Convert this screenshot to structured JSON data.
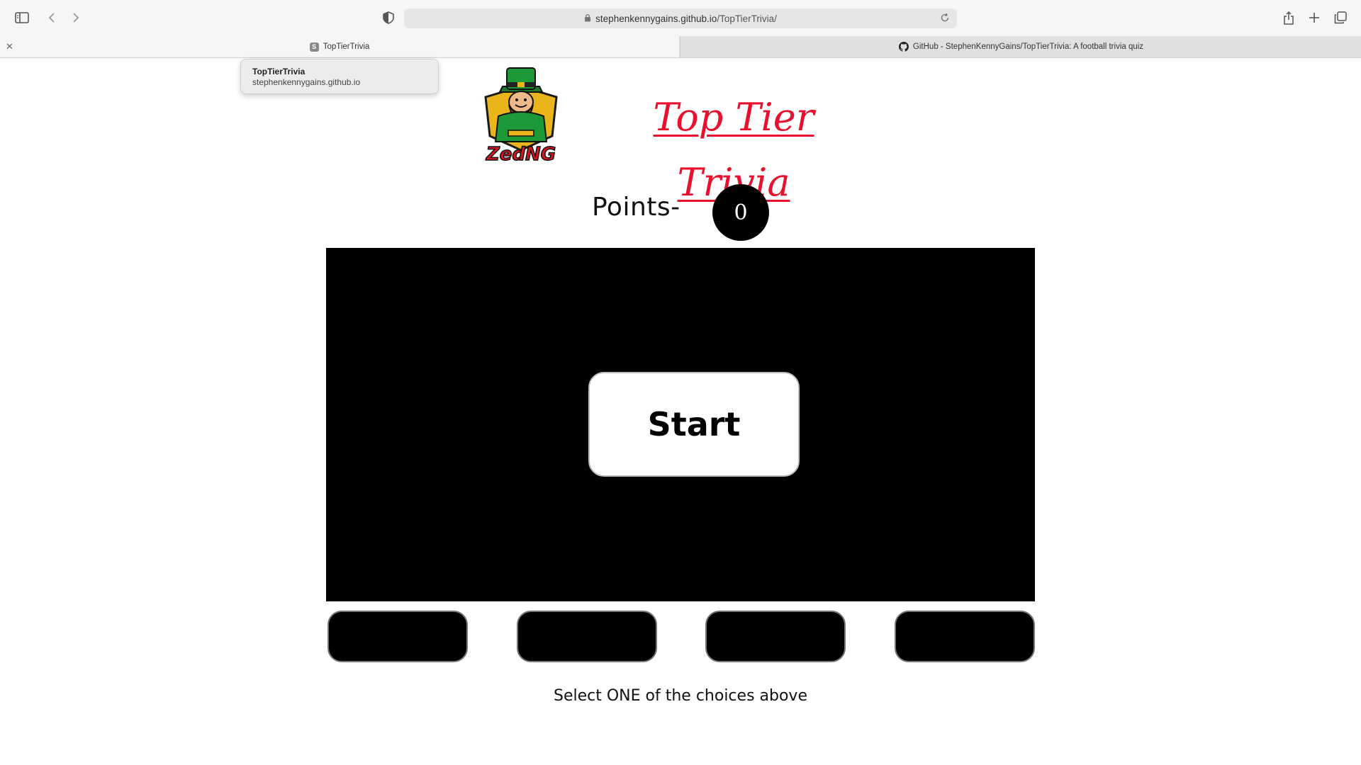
{
  "browser": {
    "url_domain": "stephenkennygains.github.io",
    "url_path": "/TopTierTrivia/",
    "tabs": [
      {
        "label": "TopTierTrivia",
        "favicon": "S",
        "active": true
      },
      {
        "label": "GitHub - StephenKennyGains/TopTierTrivia: A football trivia quiz",
        "active": false
      }
    ],
    "tooltip": {
      "title": "TopTierTrivia",
      "domain": "stephenkennygains.github.io"
    },
    "icons": [
      "sidebar-icon",
      "back-icon",
      "forward-icon",
      "shield-icon",
      "lock-icon",
      "reload-icon",
      "share-icon",
      "new-tab-icon",
      "tab-overview-icon",
      "close-tab-icon"
    ]
  },
  "page": {
    "logo_text": "ZedNG",
    "title_line1": "Top Tier",
    "title_line2": "Trivia",
    "title_color": "#e8112d",
    "points_label": "Points-",
    "points_value": "0",
    "start_label": "Start",
    "choices": [
      "",
      "",
      "",
      ""
    ],
    "instruction": "Select ONE of the choices above"
  }
}
